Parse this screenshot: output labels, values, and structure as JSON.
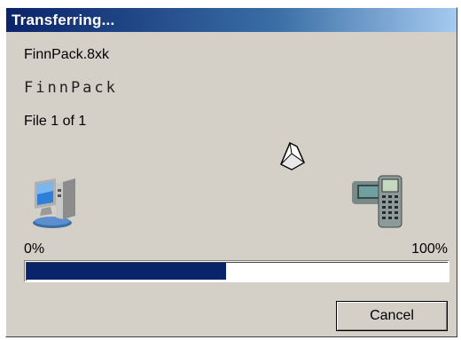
{
  "window": {
    "title": "Transferring..."
  },
  "transfer": {
    "filename": "FinnPack.8xk",
    "app_name": "FinnPack",
    "file_count": "File 1 of 1",
    "progress_fraction": 0.475,
    "min_label": "0%",
    "max_label": "100%"
  },
  "icons": {
    "source": "computer-icon",
    "item": "paper-icon",
    "destination": "calculator-icon"
  },
  "buttons": {
    "cancel_label": "Cancel"
  },
  "colors": {
    "progress": "#0a246a",
    "titlebar_start": "#0a246a",
    "titlebar_end": "#a6caf0",
    "dialog_bg": "#d4d0c8"
  }
}
